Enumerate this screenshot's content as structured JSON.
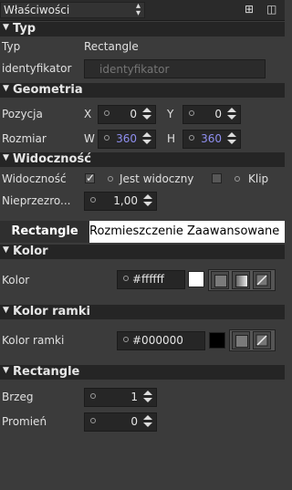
{
  "topbar": {
    "combo_label": "Właściwości"
  },
  "sections": {
    "typ": "Typ",
    "geometria": "Geometria",
    "widocznosc": "Widoczność",
    "kolor": "Kolor",
    "kolor_ramki": "Kolor ramki",
    "rectangle": "Rectangle"
  },
  "typ": {
    "type_label": "Typ",
    "type_value": "Rectangle",
    "id_label": "identyfikator",
    "id_placeholder": "identyfikator"
  },
  "geometria": {
    "pos_label": "Pozycja",
    "x_label": "X",
    "x_value": "0",
    "y_label": "Y",
    "y_value": "0",
    "size_label": "Rozmiar",
    "w_label": "W",
    "w_value": "360",
    "h_label": "H",
    "h_value": "360"
  },
  "widocznosc": {
    "vis_label": "Widoczność",
    "visible_text": "Jest widoczny",
    "clip_text": "Klip",
    "opacity_label": "Nieprzezro...",
    "opacity_value": "1,00"
  },
  "tabs": [
    "Rectangle",
    "Rozmieszczenie",
    "Zaawansowane"
  ],
  "kolor": {
    "label": "Kolor",
    "value": "#ffffff",
    "swatch": "#ffffff"
  },
  "kolor_ramki": {
    "label": "Kolor ramki",
    "value": "#000000",
    "swatch": "#000000"
  },
  "rect": {
    "border_label": "Brzeg",
    "border_value": "1",
    "radius_label": "Promień",
    "radius_value": "0"
  }
}
